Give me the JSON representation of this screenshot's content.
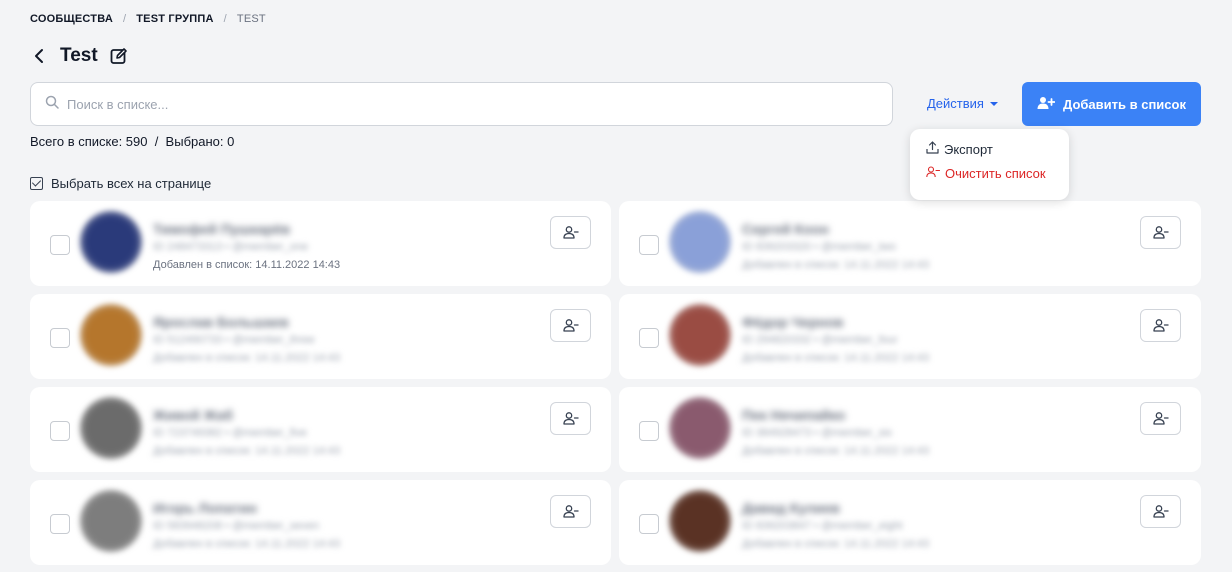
{
  "breadcrumb": {
    "items": [
      "СООБЩЕСТВА",
      "TEST ГРУППА",
      "TEST"
    ],
    "separator": "/"
  },
  "page": {
    "title": "Test"
  },
  "search": {
    "placeholder": "Поиск в списке...",
    "value": ""
  },
  "actions": {
    "label": "Действия"
  },
  "add_button": {
    "label": "Добавить в список"
  },
  "dropdown": {
    "export_label": "Экспорт",
    "clear_label": "Очистить список"
  },
  "totals": {
    "text": "Всего в списке: 590  /  Выбрано: 0"
  },
  "select_all": {
    "label": "Выбрать всех на странице",
    "checked": true
  },
  "colors": {
    "accent": "#3b82f6",
    "link": "#2563eb",
    "danger": "#dc2626"
  },
  "members": [
    {
      "name": "Тимофей Пушкарёв",
      "meta": "ID 248473313 • @member_one",
      "added": "Добавлен в список: 14.11.2022 14:43",
      "avatar_color": "#2a3a7a"
    },
    {
      "name": "Сергей Коон",
      "meta": "ID 839203320 • @member_two",
      "added": "Добавлен в список: 14.11.2022 14:43",
      "avatar_color": "#8aa0d8"
    },
    {
      "name": "Ярослав Большаев",
      "meta": "ID 512490733 • @member_three",
      "added": "Добавлен в список: 14.11.2022 14:43",
      "avatar_color": "#b5762c"
    },
    {
      "name": "Фёдор Чернов",
      "meta": "ID 294820332 • @member_four",
      "added": "Добавлен в список: 14.11.2022 14:43",
      "avatar_color": "#9a4c43"
    },
    {
      "name": "Живой Жаб",
      "meta": "ID 723749382 • @member_five",
      "added": "Добавлен в список: 14.11.2022 14:43",
      "avatar_color": "#6b6b6b"
    },
    {
      "name": "Пек Нечипайко",
      "meta": "ID 384928473 • @member_six",
      "added": "Добавлен в список: 14.11.2022 14:43",
      "avatar_color": "#8a5a6e"
    },
    {
      "name": "Игорь Лопатин",
      "meta": "ID 583948208 • @member_seven",
      "added": "Добавлен в список: 14.11.2022 14:43",
      "avatar_color": "#7d7d7d"
    },
    {
      "name": "Давид Кулиев",
      "meta": "ID 839203847 • @member_eight",
      "added": "Добавлен в список: 14.11.2022 14:43",
      "avatar_color": "#5a3224"
    }
  ]
}
